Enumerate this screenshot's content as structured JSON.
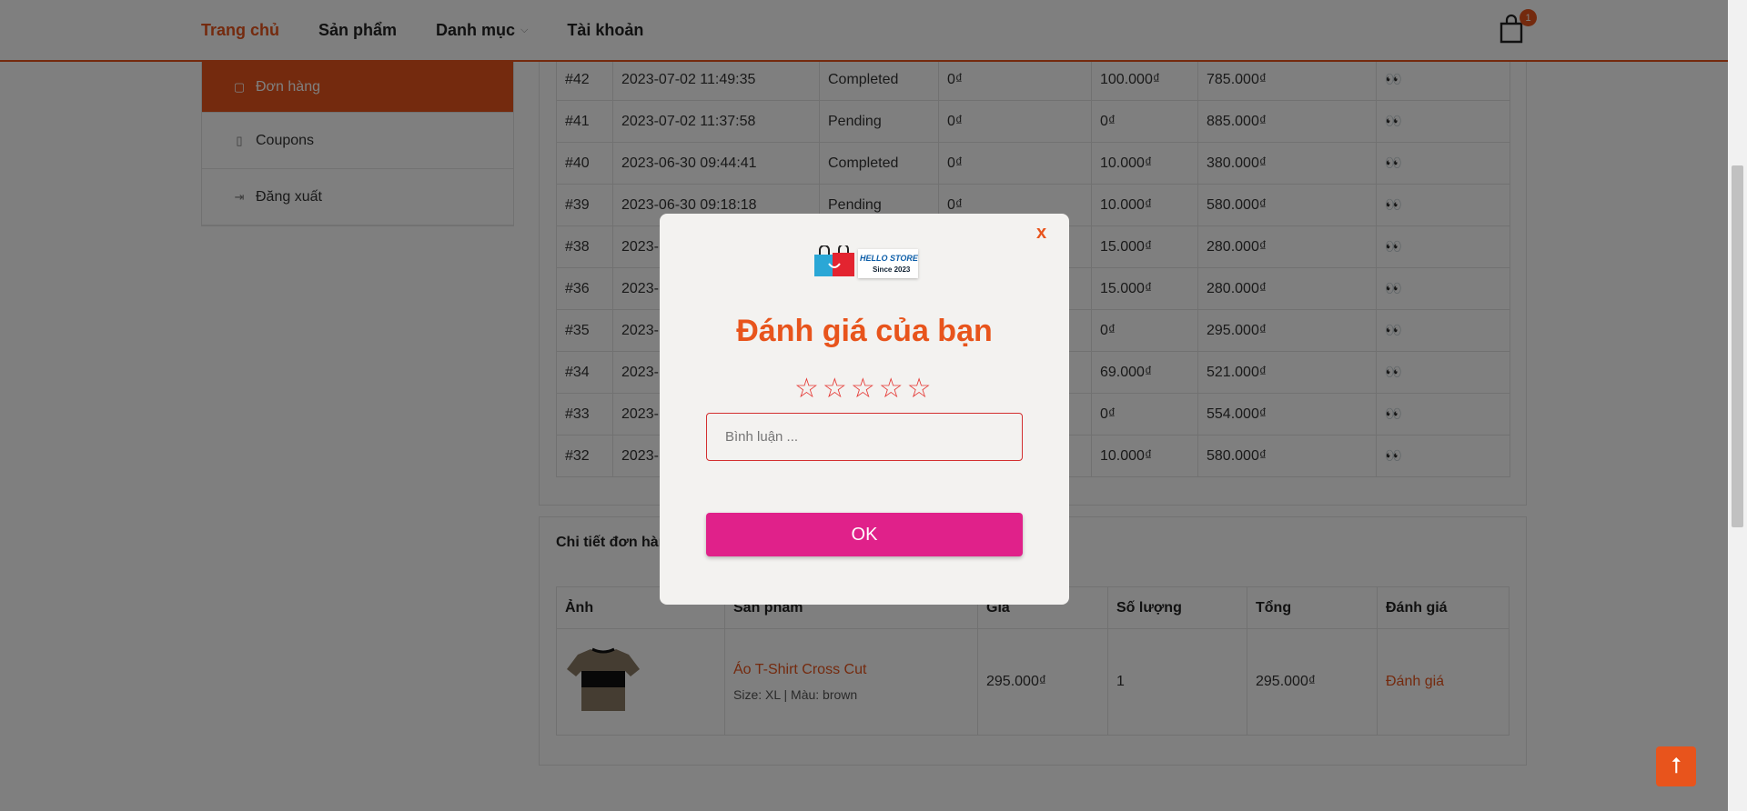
{
  "nav": {
    "items": [
      {
        "label": "Trang chủ",
        "active": true
      },
      {
        "label": "Sản phẩm",
        "active": false
      },
      {
        "label": "Danh mục",
        "active": false
      },
      {
        "label": "Tài khoản",
        "active": false
      }
    ],
    "cart_count": "1",
    "cart_icon": "shopping-bag-icon"
  },
  "sidebar": {
    "items": [
      {
        "label": "Đơn hàng",
        "icon": "bag-icon",
        "active": true
      },
      {
        "label": "Coupons",
        "icon": "coupon-icon",
        "active": false
      },
      {
        "label": "Đăng xuất",
        "icon": "logout-icon",
        "active": false
      }
    ]
  },
  "orders": {
    "rows": [
      {
        "id": "#42",
        "date": "2023-07-02 11:49:35",
        "status": "Completed",
        "discount": "0₫",
        "ship": "100.000₫",
        "total": "785.000₫"
      },
      {
        "id": "#41",
        "date": "2023-07-02 11:37:58",
        "status": "Pending",
        "discount": "0₫",
        "ship": "0₫",
        "total": "885.000₫"
      },
      {
        "id": "#40",
        "date": "2023-06-30 09:44:41",
        "status": "Completed",
        "discount": "0₫",
        "ship": "10.000₫",
        "total": "380.000₫"
      },
      {
        "id": "#39",
        "date": "2023-06-30 09:18:18",
        "status": "Pending",
        "discount": "0₫",
        "ship": "10.000₫",
        "total": "580.000₫"
      },
      {
        "id": "#38",
        "date": "2023-",
        "status": "",
        "discount": "",
        "ship": "15.000₫",
        "total": "280.000₫"
      },
      {
        "id": "#36",
        "date": "2023-",
        "status": "",
        "discount": "",
        "ship": "15.000₫",
        "total": "280.000₫"
      },
      {
        "id": "#35",
        "date": "2023-",
        "status": "",
        "discount": "",
        "ship": "0₫",
        "total": "295.000₫"
      },
      {
        "id": "#34",
        "date": "2023-",
        "status": "",
        "discount": "",
        "ship": "69.000₫",
        "total": "521.000₫"
      },
      {
        "id": "#33",
        "date": "2023-",
        "status": "",
        "discount": "",
        "ship": "0₫",
        "total": "554.000₫"
      },
      {
        "id": "#32",
        "date": "2023-",
        "status": "",
        "discount": "",
        "ship": "10.000₫",
        "total": "580.000₫"
      }
    ],
    "view_icon": "👀"
  },
  "detail": {
    "title": "Chi tiết đơn hàn",
    "headers": [
      "Ảnh",
      "Sản phẩm",
      "Giá",
      "Số lượng",
      "Tổng",
      "Đánh giá"
    ],
    "product": {
      "name": "Áo T-Shirt Cross Cut",
      "variant": "Size: XL | Màu: brown",
      "price": "295.000₫",
      "qty": "1",
      "total": "295.000₫",
      "rate_label": "Đánh giá"
    }
  },
  "modal": {
    "close_label": "x",
    "logo_name": "HELLO STORE",
    "logo_since": "Since 2023",
    "title": "Đánh giá của bạn",
    "stars": [
      "☆",
      "☆",
      "☆",
      "☆",
      "☆"
    ],
    "comment_placeholder": "Bình luận ...",
    "ok_label": "OK"
  },
  "scroll_top_icon": "⭡",
  "colors": {
    "accent": "#e8541c",
    "ok_button": "#e0218a",
    "star": "#e53935"
  }
}
